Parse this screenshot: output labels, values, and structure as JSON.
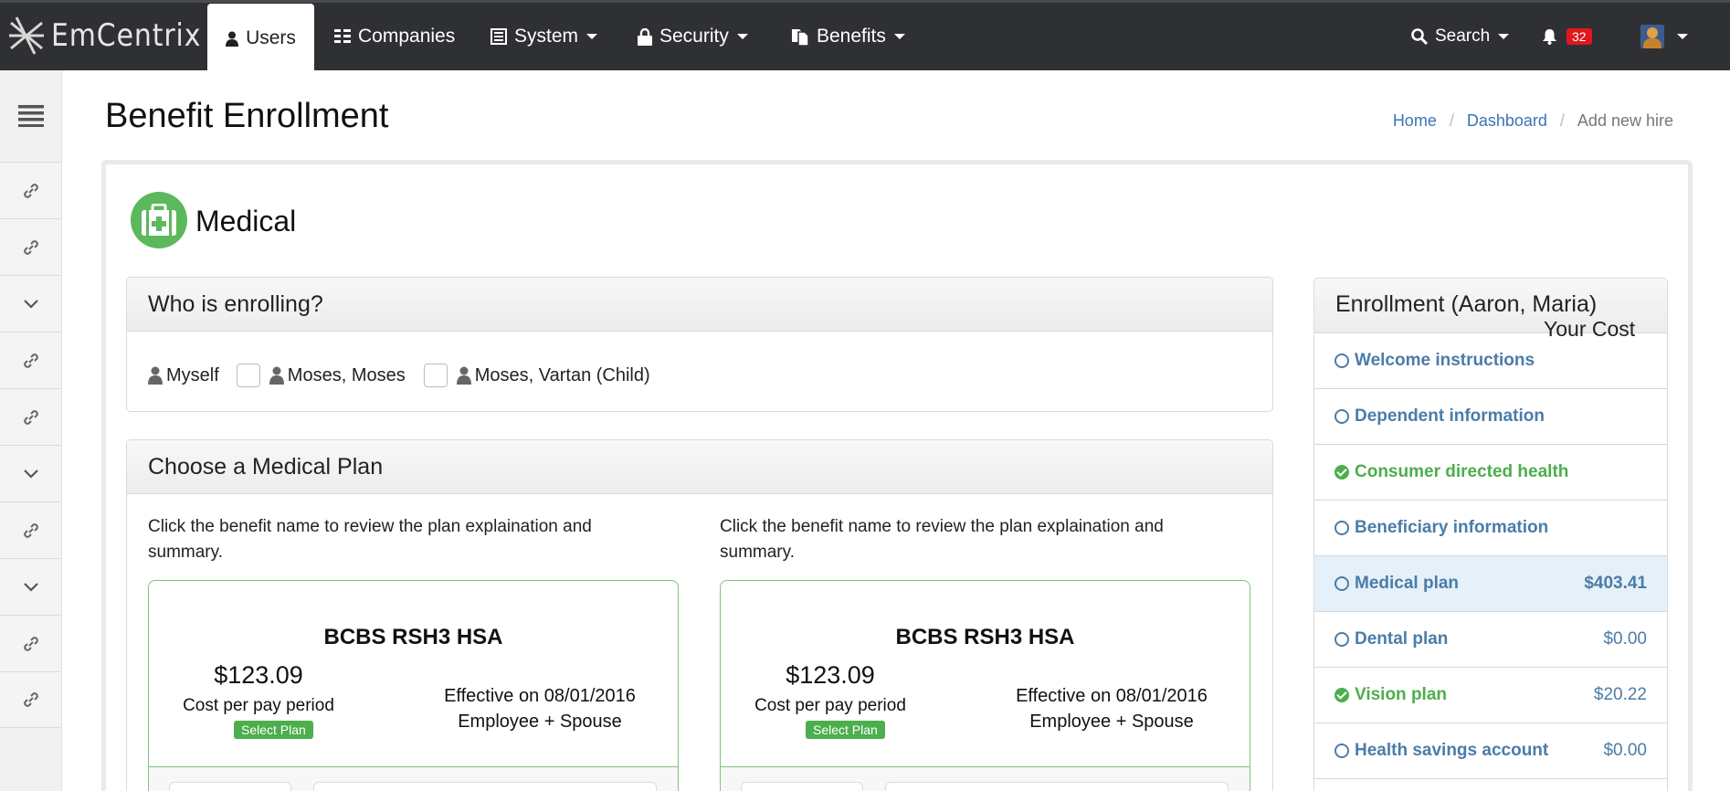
{
  "brand": {
    "name": "EmCentrix"
  },
  "nav": {
    "users": "Users",
    "companies": "Companies",
    "system": "System",
    "security": "Security",
    "benefits": "Benefits",
    "search": "Search",
    "notifications_count": "32"
  },
  "page": {
    "title": "Benefit Enrollment",
    "breadcrumb": {
      "home": "Home",
      "dashboard": "Dashboard",
      "current": "Add new hire"
    },
    "section_title": "Medical"
  },
  "who_enrolling": {
    "title": "Who is enrolling?",
    "people": [
      {
        "label": "Myself"
      },
      {
        "label": "Moses, Moses"
      },
      {
        "label": "Moses, Vartan (Child)"
      }
    ]
  },
  "choose_plan": {
    "title": "Choose a Medical Plan",
    "cards": [
      {
        "description": "Click the benefit name to review the plan explaination and summary.",
        "plan_name": "BCBS RSH3 HSA",
        "cost": "$123.09",
        "cost_label": "Cost per pay period",
        "select_label": "Select Plan",
        "effective": "Effective on 08/01/2016",
        "coverage": "Employee + Spouse"
      },
      {
        "description": "Click the benefit name to review the plan explaination and summary.",
        "plan_name": "BCBS RSH3 HSA",
        "cost": "$123.09",
        "cost_label": "Cost per pay period",
        "select_label": "Select Plan",
        "effective": "Effective on 08/01/2016",
        "coverage": "Employee + Spouse"
      }
    ]
  },
  "enrollment": {
    "title": "Enrollment (Aaron, Maria)",
    "cost_header": "Your Cost",
    "steps": [
      {
        "label": "Welcome instructions",
        "amount": "",
        "status": "pending"
      },
      {
        "label": "Dependent information",
        "amount": "",
        "status": "pending"
      },
      {
        "label": "Consumer directed health",
        "amount": "",
        "status": "done"
      },
      {
        "label": "Beneficiary information",
        "amount": "",
        "status": "pending"
      },
      {
        "label": "Medical plan",
        "amount": "$403.41",
        "status": "active"
      },
      {
        "label": "Dental plan",
        "amount": "$0.00",
        "status": "pending"
      },
      {
        "label": "Vision plan",
        "amount": "$20.22",
        "status": "done"
      },
      {
        "label": "Health savings account",
        "amount": "$0.00",
        "status": "pending"
      }
    ]
  },
  "colors": {
    "nav_bg": "#2f3033",
    "link": "#3a74b4",
    "success": "#4cae4c",
    "step_text": "#4b7ca8",
    "badge": "#e0171d"
  }
}
